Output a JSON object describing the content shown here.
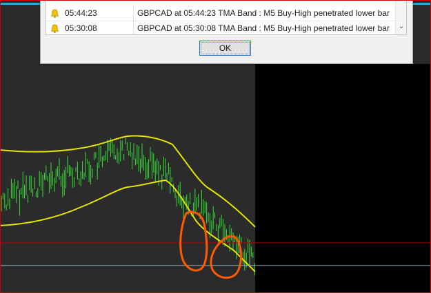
{
  "alerts": {
    "rows": [
      {
        "time": "05:44:23",
        "message": "GBPCAD at 05:44:23 TMA Band : M5 Buy-High penetrated lower bar"
      },
      {
        "time": "05:30:08",
        "message": "GBPCAD at 05:30:08 TMA Band : M5 Buy-High penetrated lower bar"
      }
    ],
    "ok_label": "OK",
    "scroll_down_glyph": "⌄"
  },
  "colors": {
    "chart_background": "#2b2b2b",
    "future_area": "#000000",
    "candles": "#33e033",
    "bands": "#e6e600",
    "resistance_line": "#b00000",
    "bid_line": "#9fb8c8",
    "annotation": "#ff5a00",
    "frame": "#d00000",
    "accent": "#27a6df"
  }
}
